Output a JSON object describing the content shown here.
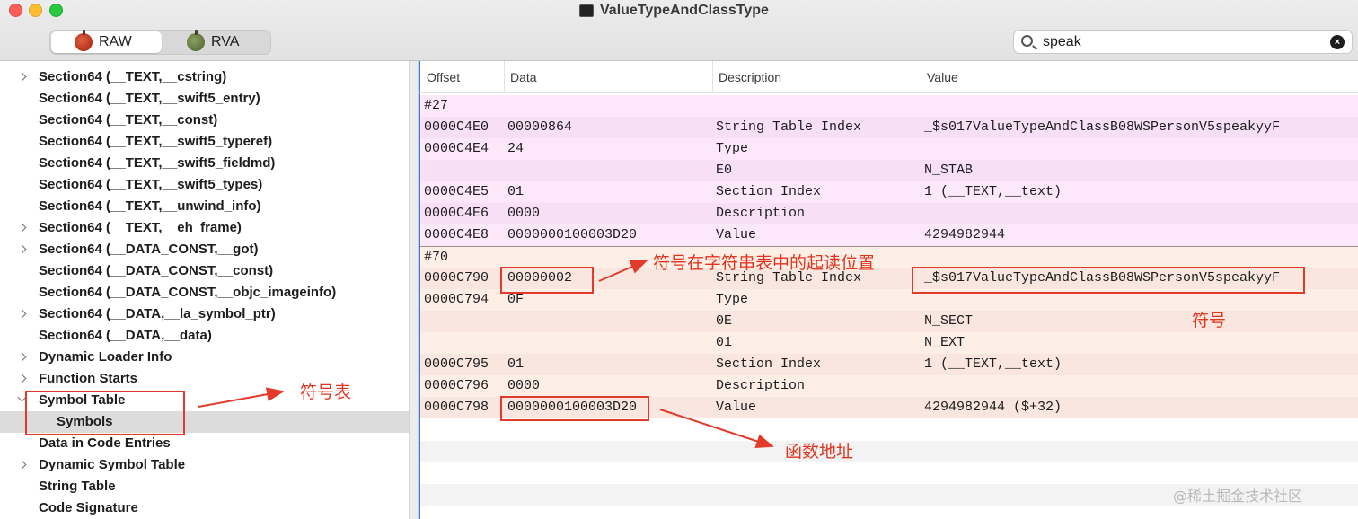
{
  "window": {
    "title": "ValueTypeAndClassType"
  },
  "toolbar": {
    "segments": [
      {
        "label": "RAW",
        "icon": "apple-red-icon",
        "selected": true
      },
      {
        "label": "RVA",
        "icon": "apple-green-icon",
        "selected": false
      }
    ],
    "search": {
      "value": "speak"
    }
  },
  "sidebar": {
    "items": [
      {
        "label": "Section64 (__TEXT,__cstring)",
        "expandable": true,
        "selected": false
      },
      {
        "label": "Section64 (__TEXT,__swift5_entry)",
        "expandable": false,
        "selected": false
      },
      {
        "label": "Section64 (__TEXT,__const)",
        "expandable": false,
        "selected": false
      },
      {
        "label": "Section64 (__TEXT,__swift5_typeref)",
        "expandable": false,
        "selected": false
      },
      {
        "label": "Section64 (__TEXT,__swift5_fieldmd)",
        "expandable": false,
        "selected": false
      },
      {
        "label": "Section64 (__TEXT,__swift5_types)",
        "expandable": false,
        "selected": false
      },
      {
        "label": "Section64 (__TEXT,__unwind_info)",
        "expandable": false,
        "selected": false
      },
      {
        "label": "Section64 (__TEXT,__eh_frame)",
        "expandable": true,
        "selected": false
      },
      {
        "label": "Section64 (__DATA_CONST,__got)",
        "expandable": true,
        "selected": false
      },
      {
        "label": "Section64 (__DATA_CONST,__const)",
        "expandable": false,
        "selected": false
      },
      {
        "label": "Section64 (__DATA_CONST,__objc_imageinfo)",
        "expandable": false,
        "selected": false
      },
      {
        "label": "Section64 (__DATA,__la_symbol_ptr)",
        "expandable": true,
        "selected": false
      },
      {
        "label": "Section64 (__DATA,__data)",
        "expandable": false,
        "selected": false
      },
      {
        "label": "Dynamic Loader Info",
        "expandable": true,
        "selected": false
      },
      {
        "label": "Function Starts",
        "expandable": true,
        "selected": false
      },
      {
        "label": "Symbol Table",
        "expandable": true,
        "expanded": true,
        "selected": false
      },
      {
        "label": "Symbols",
        "expandable": false,
        "child": true,
        "selected": true
      },
      {
        "label": "Data in Code Entries",
        "expandable": false,
        "selected": false
      },
      {
        "label": "Dynamic Symbol Table",
        "expandable": true,
        "selected": false
      },
      {
        "label": "String Table",
        "expandable": false,
        "selected": false
      },
      {
        "label": "Code Signature",
        "expandable": false,
        "selected": false
      }
    ]
  },
  "table": {
    "columns": [
      "Offset",
      "Data",
      "Description",
      "Value"
    ],
    "rows": [
      {
        "offset": "#27",
        "data": "",
        "desc": "",
        "value": ""
      },
      {
        "offset": "0000C4E0",
        "data": "00000864",
        "desc": "String Table Index",
        "value": "_$s017ValueTypeAndClassB08WSPersonV5speakyyF"
      },
      {
        "offset": "0000C4E4",
        "data": "24",
        "desc": "Type",
        "value": ""
      },
      {
        "offset": "",
        "data": "",
        "desc": "E0",
        "value": "N_STAB"
      },
      {
        "offset": "0000C4E5",
        "data": "01",
        "desc": "Section Index",
        "value": "1 (__TEXT,__text)"
      },
      {
        "offset": "0000C4E6",
        "data": "0000",
        "desc": "Description",
        "value": ""
      },
      {
        "offset": "0000C4E8",
        "data": "0000000100003D20",
        "desc": "Value",
        "value": "4294982944"
      },
      {
        "offset": "#70",
        "data": "",
        "desc": "",
        "value": ""
      },
      {
        "offset": "0000C790",
        "data": "00000002",
        "desc": "String Table Index",
        "value": "_$s017ValueTypeAndClassB08WSPersonV5speakyyF"
      },
      {
        "offset": "0000C794",
        "data": "0F",
        "desc": "Type",
        "value": ""
      },
      {
        "offset": "",
        "data": "",
        "desc": "0E",
        "value": "N_SECT"
      },
      {
        "offset": "",
        "data": "",
        "desc": "01",
        "value": "N_EXT"
      },
      {
        "offset": "0000C795",
        "data": "01",
        "desc": "Section Index",
        "value": "1 (__TEXT,__text)"
      },
      {
        "offset": "0000C796",
        "data": "0000",
        "desc": "Description",
        "value": ""
      },
      {
        "offset": "0000C798",
        "data": "0000000100003D20",
        "desc": "Value",
        "value": "4294982944 ($+32)"
      }
    ]
  },
  "annotations": {
    "string_index_note": "符号在字符串表中的起读位置",
    "symbol_note": "符号",
    "symbol_table_note": "符号表",
    "func_addr_note": "函数地址"
  },
  "watermark": "@稀土掘金技术社区",
  "colors": {
    "group1_bg": "#fde7fb",
    "group2_bg": "#fdeee6",
    "annotation": "#e23a2b",
    "selection": "#dcdcdc"
  }
}
